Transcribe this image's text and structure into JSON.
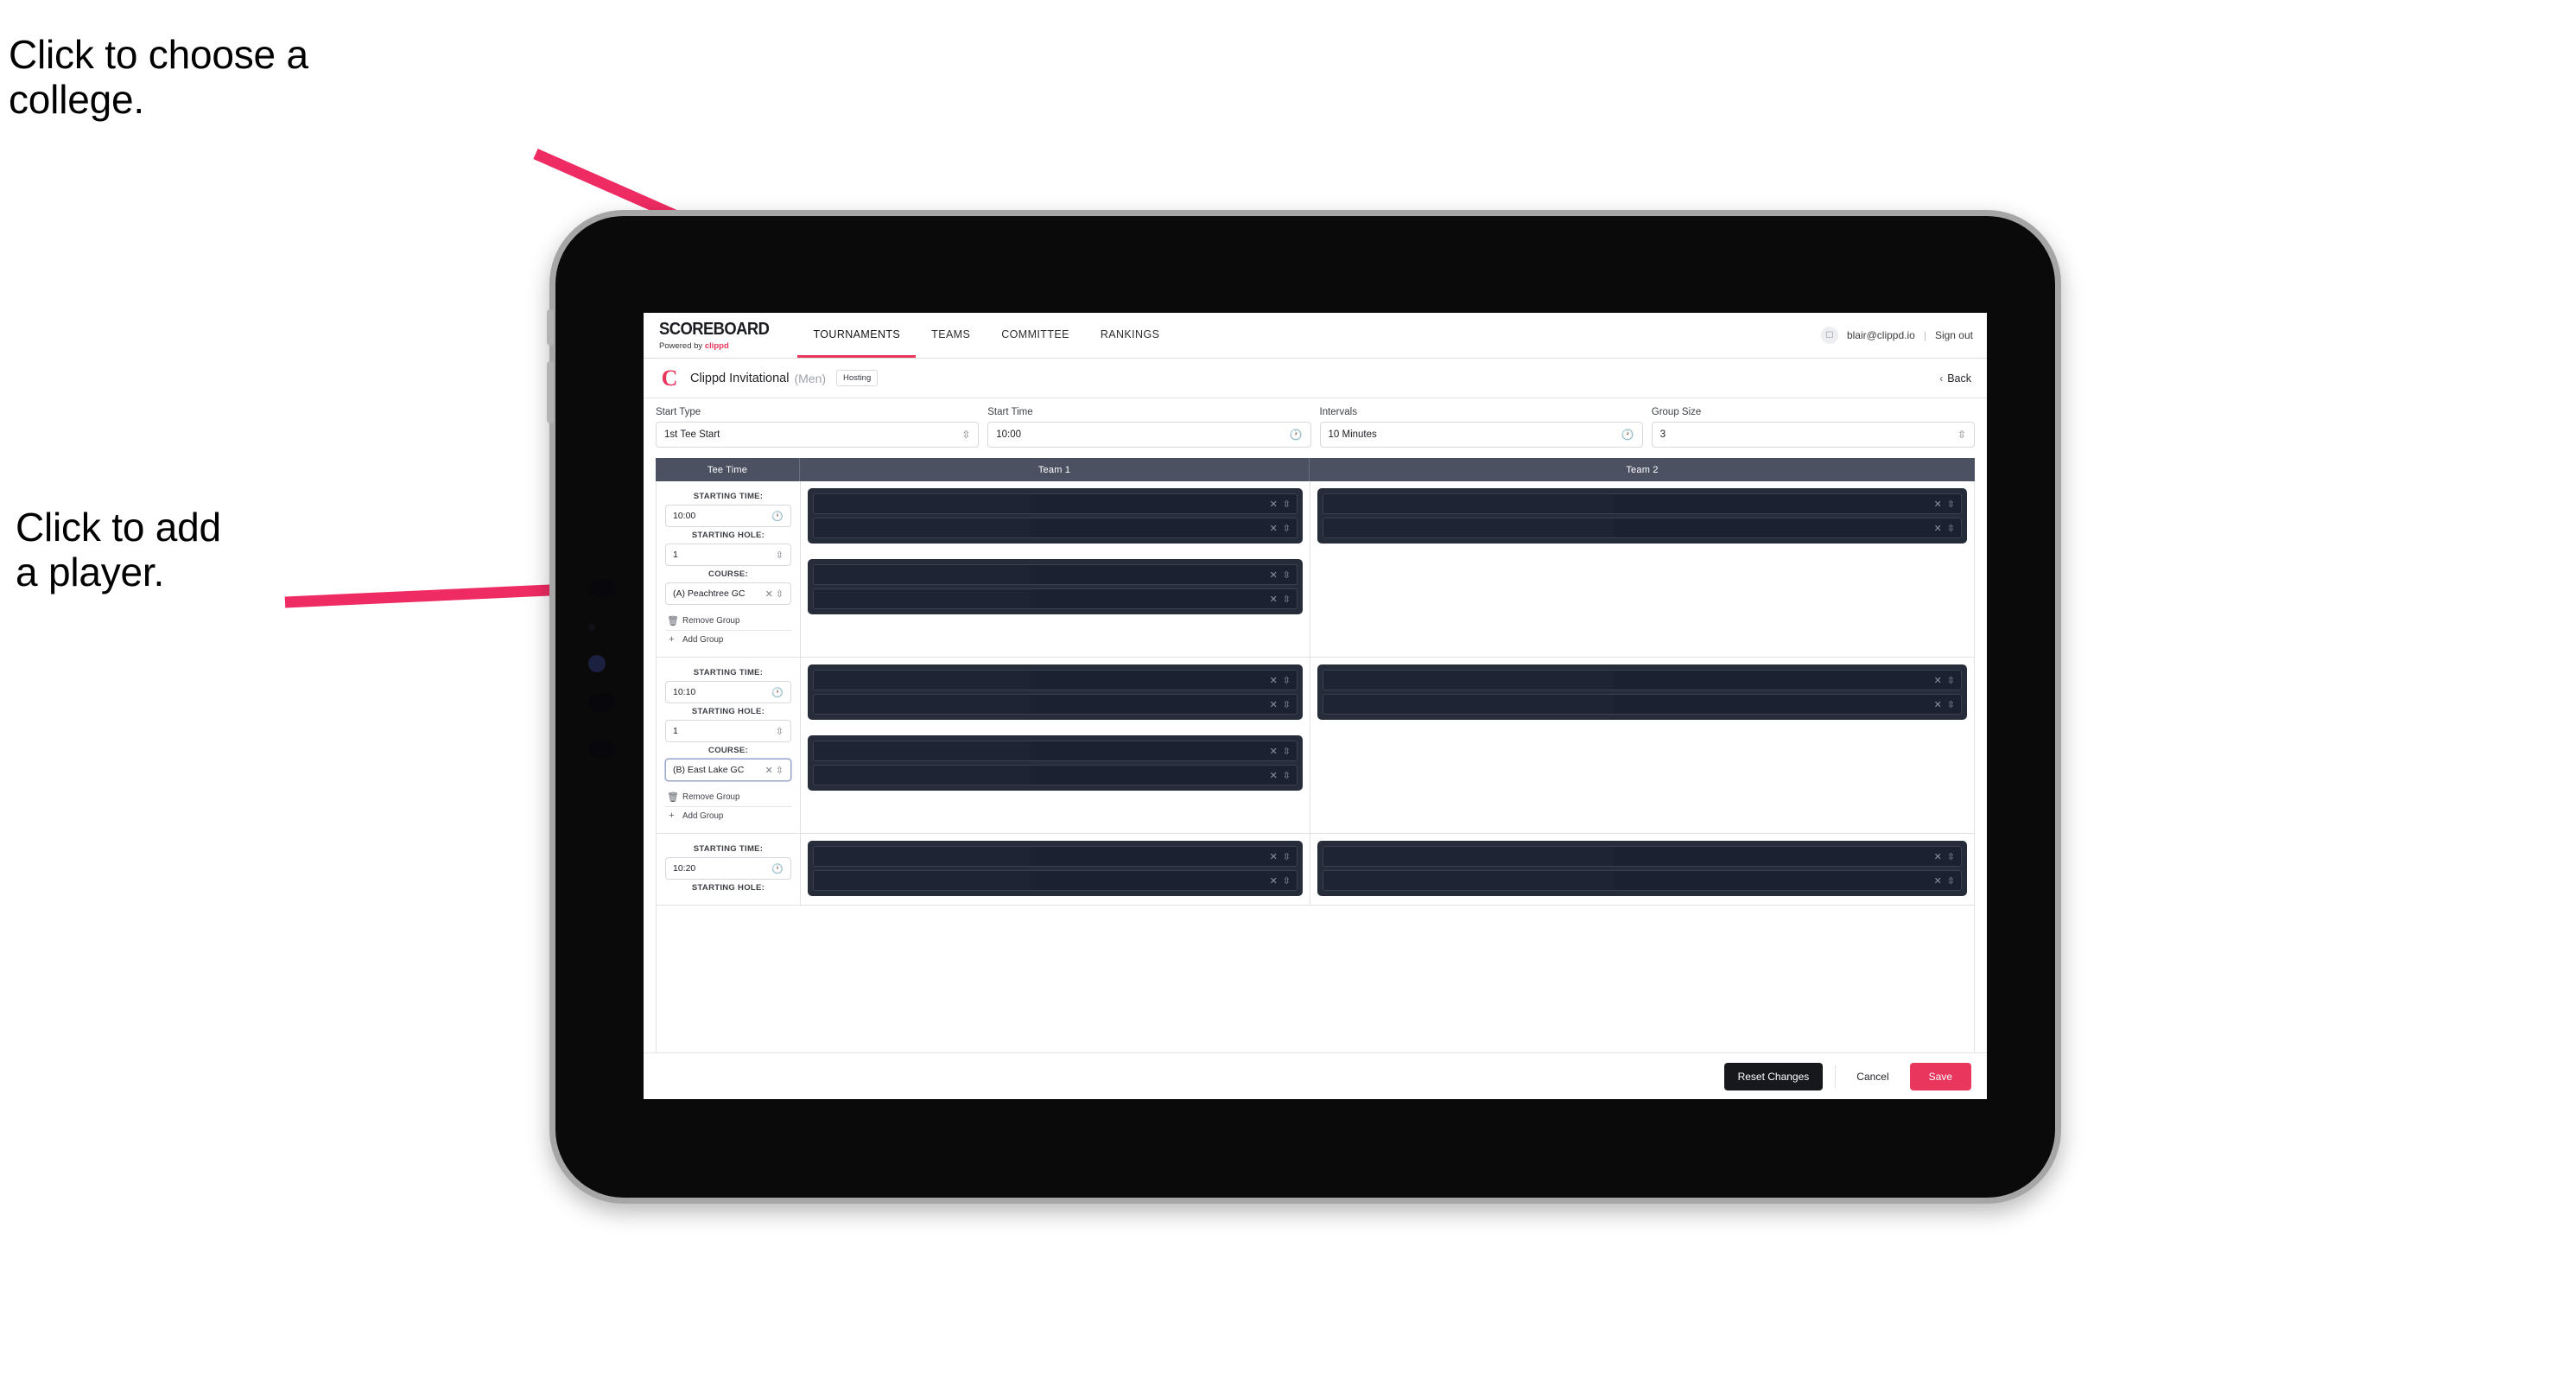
{
  "annotations": {
    "college": "Click to choose a\ncollege.",
    "player": "Click to add\na player."
  },
  "colors": {
    "accent": "#e8365d",
    "header_row": "#4b5161",
    "player_card": "#262c3a",
    "player_row": "#1b2130"
  },
  "app": {
    "brand": {
      "title": "SCOREBOARD",
      "subtitle_prefix": "Powered by ",
      "subtitle_brand": "clippd"
    },
    "nav": [
      {
        "label": "TOURNAMENTS",
        "active": true
      },
      {
        "label": "TEAMS",
        "active": false
      },
      {
        "label": "COMMITTEE",
        "active": false
      },
      {
        "label": "RANKINGS",
        "active": false
      }
    ],
    "account": {
      "avatar_icon": "user-icon",
      "email": "blair@clippd.io",
      "separator": "|",
      "sign_out": "Sign out"
    },
    "title_bar": {
      "logo_letter": "C",
      "tournament_name": "Clippd Invitational",
      "gender": "(Men)",
      "hosting_badge": "Hosting",
      "back_label": "Back",
      "back_chevron": "‹"
    },
    "filters": [
      {
        "label": "Start Type",
        "value": "1st Tee Start",
        "icon": "stepper-icon"
      },
      {
        "label": "Start Time",
        "value": "10:00",
        "icon": "clock-icon"
      },
      {
        "label": "Intervals",
        "value": "10 Minutes",
        "icon": "clock-icon"
      },
      {
        "label": "Group Size",
        "value": "3",
        "icon": "stepper-icon"
      }
    ],
    "table": {
      "columns": [
        "Tee Time",
        "Team 1",
        "Team 2"
      ],
      "field_labels": {
        "starting_time": "STARTING TIME:",
        "starting_hole": "STARTING HOLE:",
        "course": "COURSE:"
      },
      "group_actions": {
        "remove": "Remove Group",
        "remove_icon": "trash-icon",
        "add": "Add Group",
        "add_icon": "plus-icon"
      },
      "rows": [
        {
          "starting_time": "10:00",
          "starting_hole": "1",
          "course": "(A) Peachtree GC",
          "course_focused": false,
          "team1_groups": [
            2,
            2
          ],
          "team2_groups": [
            2
          ]
        },
        {
          "starting_time": "10:10",
          "starting_hole": "1",
          "course": "(B) East Lake GC",
          "course_focused": true,
          "team1_groups": [
            2,
            2
          ],
          "team2_groups": [
            2
          ]
        },
        {
          "starting_time": "10:20",
          "starting_hole": "",
          "course": "",
          "course_focused": false,
          "team1_groups": [
            2
          ],
          "team2_groups": [
            2
          ],
          "partial": true
        }
      ],
      "player_row_icons": {
        "clear": "×",
        "stepper": "⌃⌄"
      }
    },
    "footer": {
      "reset": "Reset Changes",
      "cancel": "Cancel",
      "save": "Save"
    }
  }
}
